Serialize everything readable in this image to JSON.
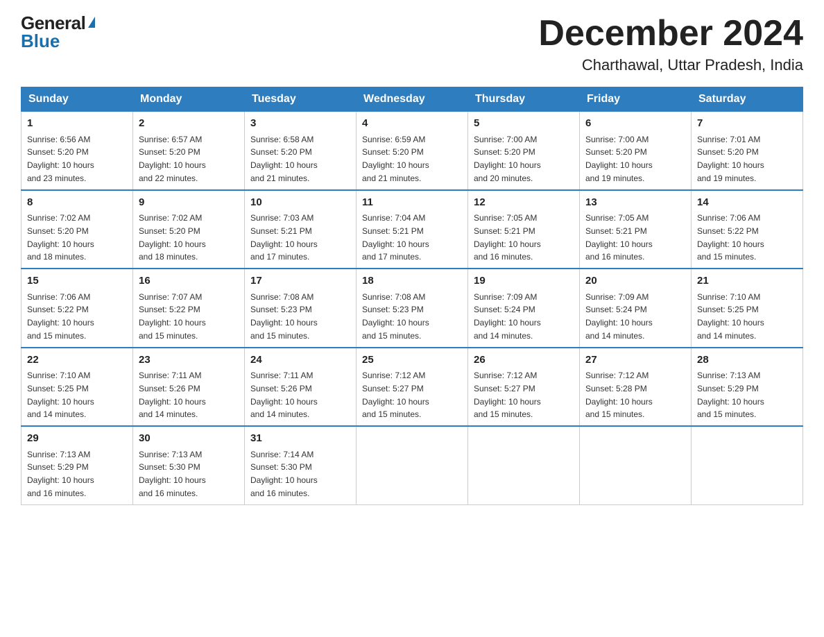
{
  "logo": {
    "general": "General",
    "blue": "Blue"
  },
  "title": "December 2024",
  "subtitle": "Charthawal, Uttar Pradesh, India",
  "days_of_week": [
    "Sunday",
    "Monday",
    "Tuesday",
    "Wednesday",
    "Thursday",
    "Friday",
    "Saturday"
  ],
  "weeks": [
    [
      {
        "day": "1",
        "sunrise": "6:56 AM",
        "sunset": "5:20 PM",
        "daylight": "10 hours and 23 minutes."
      },
      {
        "day": "2",
        "sunrise": "6:57 AM",
        "sunset": "5:20 PM",
        "daylight": "10 hours and 22 minutes."
      },
      {
        "day": "3",
        "sunrise": "6:58 AM",
        "sunset": "5:20 PM",
        "daylight": "10 hours and 21 minutes."
      },
      {
        "day": "4",
        "sunrise": "6:59 AM",
        "sunset": "5:20 PM",
        "daylight": "10 hours and 21 minutes."
      },
      {
        "day": "5",
        "sunrise": "7:00 AM",
        "sunset": "5:20 PM",
        "daylight": "10 hours and 20 minutes."
      },
      {
        "day": "6",
        "sunrise": "7:00 AM",
        "sunset": "5:20 PM",
        "daylight": "10 hours and 19 minutes."
      },
      {
        "day": "7",
        "sunrise": "7:01 AM",
        "sunset": "5:20 PM",
        "daylight": "10 hours and 19 minutes."
      }
    ],
    [
      {
        "day": "8",
        "sunrise": "7:02 AM",
        "sunset": "5:20 PM",
        "daylight": "10 hours and 18 minutes."
      },
      {
        "day": "9",
        "sunrise": "7:02 AM",
        "sunset": "5:20 PM",
        "daylight": "10 hours and 18 minutes."
      },
      {
        "day": "10",
        "sunrise": "7:03 AM",
        "sunset": "5:21 PM",
        "daylight": "10 hours and 17 minutes."
      },
      {
        "day": "11",
        "sunrise": "7:04 AM",
        "sunset": "5:21 PM",
        "daylight": "10 hours and 17 minutes."
      },
      {
        "day": "12",
        "sunrise": "7:05 AM",
        "sunset": "5:21 PM",
        "daylight": "10 hours and 16 minutes."
      },
      {
        "day": "13",
        "sunrise": "7:05 AM",
        "sunset": "5:21 PM",
        "daylight": "10 hours and 16 minutes."
      },
      {
        "day": "14",
        "sunrise": "7:06 AM",
        "sunset": "5:22 PM",
        "daylight": "10 hours and 15 minutes."
      }
    ],
    [
      {
        "day": "15",
        "sunrise": "7:06 AM",
        "sunset": "5:22 PM",
        "daylight": "10 hours and 15 minutes."
      },
      {
        "day": "16",
        "sunrise": "7:07 AM",
        "sunset": "5:22 PM",
        "daylight": "10 hours and 15 minutes."
      },
      {
        "day": "17",
        "sunrise": "7:08 AM",
        "sunset": "5:23 PM",
        "daylight": "10 hours and 15 minutes."
      },
      {
        "day": "18",
        "sunrise": "7:08 AM",
        "sunset": "5:23 PM",
        "daylight": "10 hours and 15 minutes."
      },
      {
        "day": "19",
        "sunrise": "7:09 AM",
        "sunset": "5:24 PM",
        "daylight": "10 hours and 14 minutes."
      },
      {
        "day": "20",
        "sunrise": "7:09 AM",
        "sunset": "5:24 PM",
        "daylight": "10 hours and 14 minutes."
      },
      {
        "day": "21",
        "sunrise": "7:10 AM",
        "sunset": "5:25 PM",
        "daylight": "10 hours and 14 minutes."
      }
    ],
    [
      {
        "day": "22",
        "sunrise": "7:10 AM",
        "sunset": "5:25 PM",
        "daylight": "10 hours and 14 minutes."
      },
      {
        "day": "23",
        "sunrise": "7:11 AM",
        "sunset": "5:26 PM",
        "daylight": "10 hours and 14 minutes."
      },
      {
        "day": "24",
        "sunrise": "7:11 AM",
        "sunset": "5:26 PM",
        "daylight": "10 hours and 14 minutes."
      },
      {
        "day": "25",
        "sunrise": "7:12 AM",
        "sunset": "5:27 PM",
        "daylight": "10 hours and 15 minutes."
      },
      {
        "day": "26",
        "sunrise": "7:12 AM",
        "sunset": "5:27 PM",
        "daylight": "10 hours and 15 minutes."
      },
      {
        "day": "27",
        "sunrise": "7:12 AM",
        "sunset": "5:28 PM",
        "daylight": "10 hours and 15 minutes."
      },
      {
        "day": "28",
        "sunrise": "7:13 AM",
        "sunset": "5:29 PM",
        "daylight": "10 hours and 15 minutes."
      }
    ],
    [
      {
        "day": "29",
        "sunrise": "7:13 AM",
        "sunset": "5:29 PM",
        "daylight": "10 hours and 16 minutes."
      },
      {
        "day": "30",
        "sunrise": "7:13 AM",
        "sunset": "5:30 PM",
        "daylight": "10 hours and 16 minutes."
      },
      {
        "day": "31",
        "sunrise": "7:14 AM",
        "sunset": "5:30 PM",
        "daylight": "10 hours and 16 minutes."
      },
      null,
      null,
      null,
      null
    ]
  ],
  "labels": {
    "sunrise": "Sunrise:",
    "sunset": "Sunset:",
    "daylight": "Daylight:"
  }
}
